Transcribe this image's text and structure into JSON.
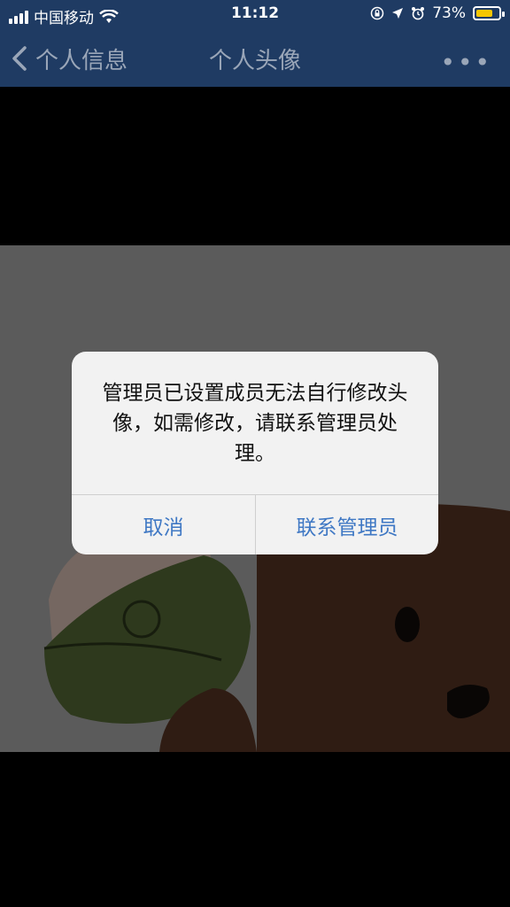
{
  "status_bar": {
    "carrier": "中国移动",
    "time": "11:12",
    "battery_percent": "73%",
    "battery_level": 0.73,
    "icons": [
      "signal-icon",
      "wifi-icon",
      "lock-rotation-icon",
      "location-icon",
      "alarm-icon",
      "battery-icon"
    ]
  },
  "nav": {
    "back_label": "个人信息",
    "title": "个人头像",
    "more_icon": "more-dots-icon"
  },
  "alert": {
    "message": "管理员已设置成员无法自行修改头像，如需修改，请联系管理员处理。",
    "cancel_label": "取消",
    "contact_label": "联系管理员",
    "button_color": "#3f78c4"
  },
  "colors": {
    "nav_bar": "#1f3b63",
    "battery": "#f6c600"
  }
}
